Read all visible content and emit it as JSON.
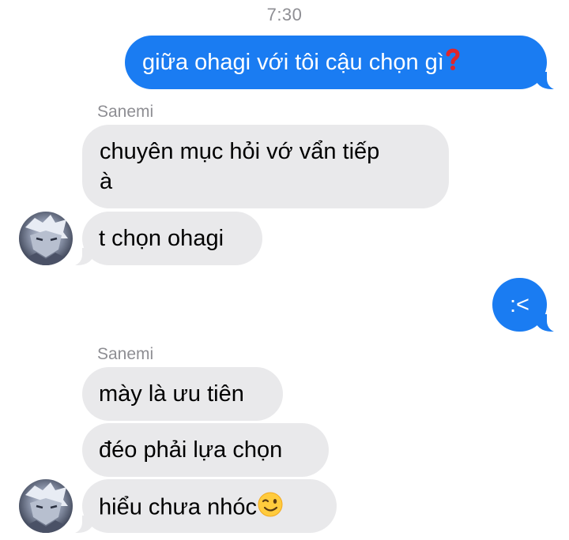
{
  "status_time": "7:30",
  "contact": {
    "name": "Sanemi"
  },
  "messages": [
    {
      "from": "me",
      "text": "giữa ohagi với tôi cậu chọn gì",
      "icon": "red-question-mark-icon"
    },
    {
      "from": "Sanemi",
      "lines": [
        "chuyên mục hỏi vớ vẩn tiếp",
        "à"
      ]
    },
    {
      "from": "Sanemi",
      "text": "t chọn ohagi"
    },
    {
      "from": "me",
      "text": ":<"
    },
    {
      "from": "Sanemi",
      "text": "mày là ưu tiên"
    },
    {
      "from": "Sanemi",
      "text": "đéo phải lựa chọn"
    },
    {
      "from": "Sanemi",
      "text": "hiểu chưa nhóc",
      "icon": "winking-face-icon"
    }
  ],
  "colors": {
    "outgoing": "#1a7cf2",
    "incoming": "#e9e9eb",
    "meta_text": "#8e8e93"
  }
}
